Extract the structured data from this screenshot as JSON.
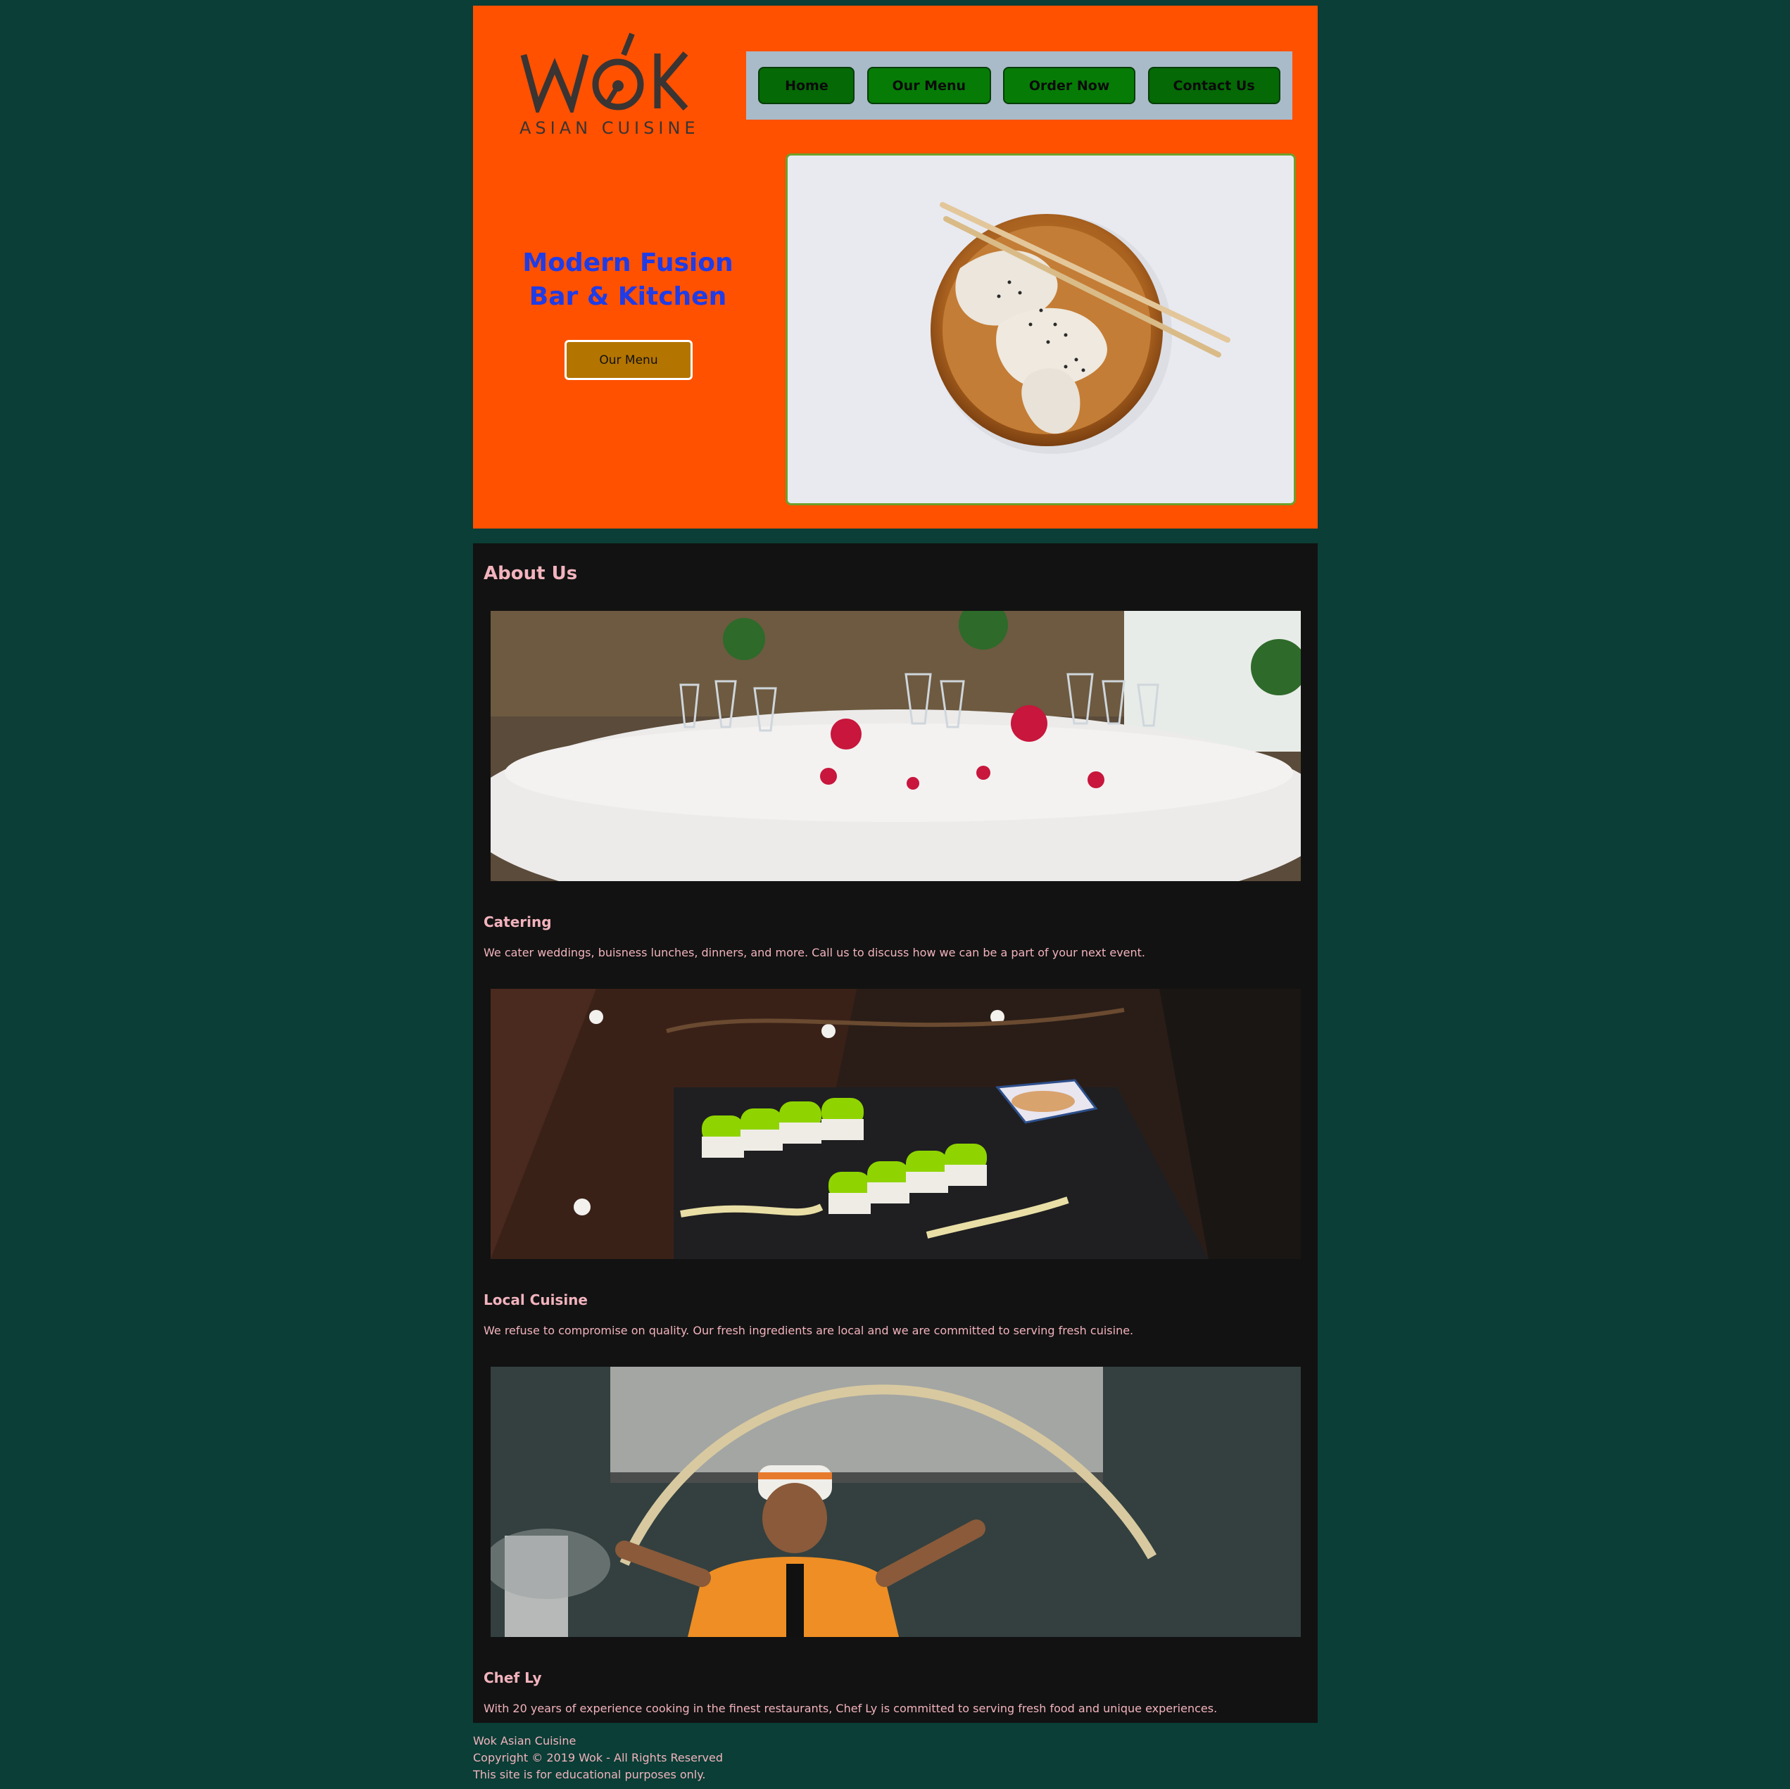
{
  "brand": {
    "logo_word": "WŎK",
    "logo_sub": "ASIAN CUISINE"
  },
  "nav": {
    "items": [
      {
        "label": "Home"
      },
      {
        "label": "Our Menu"
      },
      {
        "label": "Order Now"
      },
      {
        "label": "Contact Us"
      }
    ]
  },
  "hero": {
    "tagline_line1": "Modern Fusion",
    "tagline_line2": "Bar & Kitchen",
    "cta_label": "Our Menu"
  },
  "about": {
    "title": "About Us",
    "features": [
      {
        "title": "Catering",
        "text": "We cater weddings, buisness lunches, dinners, and more. Call us to discuss how we can be a part of your next event."
      },
      {
        "title": "Local Cuisine",
        "text": "We refuse to compromise on quality. Our fresh ingredients are local and we are committed to serving fresh cuisine."
      },
      {
        "title": "Chef Ly",
        "text": "With 20 years of experience cooking in the finest restaurants, Chef Ly is committed to serving fresh food and unique experiences."
      }
    ]
  },
  "footer": {
    "line1": "Wok Asian Cuisine",
    "line2": "Copyright © 2019 Wok - All Rights Reserved",
    "line3": "This site is for educational purposes only."
  },
  "colors": {
    "page_bg": "#0a3e36",
    "header_bg": "#ff5100",
    "nav_bg": "#a9bac9",
    "nav_button": "#067c06",
    "tagline": "#1f3ce6",
    "cta_bg": "#b37400",
    "about_bg": "#121212",
    "about_text": "#f2b3bd"
  }
}
